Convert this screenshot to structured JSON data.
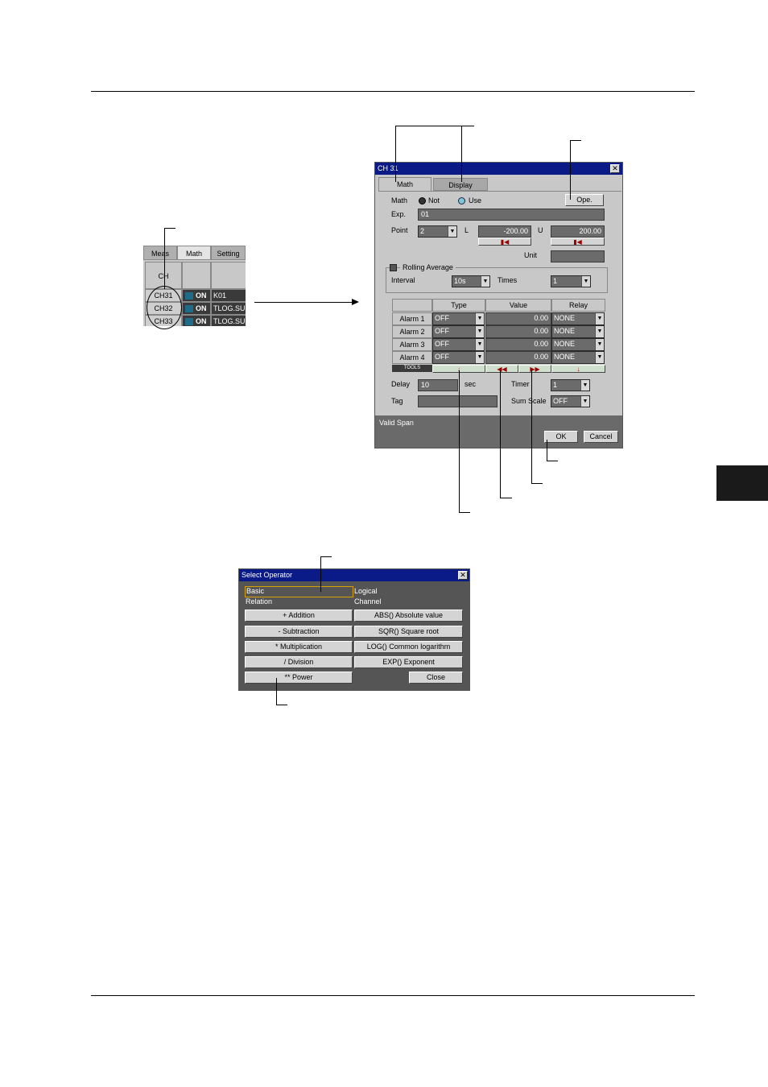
{
  "channel_list": {
    "tabs": [
      "Meas",
      "Math",
      "Setting"
    ],
    "ch_header": "CH",
    "rows": [
      {
        "ch": "CH31",
        "status": "ON",
        "expr": "K01"
      },
      {
        "ch": "CH32",
        "status": "ON",
        "expr": "TLOG.SUM"
      },
      {
        "ch": "CH33",
        "status": "ON",
        "expr": "TLOG.SUM"
      }
    ]
  },
  "dialog": {
    "title": "CH 31",
    "tabs": [
      "Math",
      "Display"
    ],
    "math_label": "Math",
    "math_not": "Not",
    "math_use": "Use",
    "ope_button": "Ope.",
    "exp_label": "Exp.",
    "exp_value": "01",
    "point_label": "Point",
    "point_value": "2",
    "l_label": "L",
    "l_value": "-200.00",
    "u_label": "U",
    "u_value": "200.00",
    "unit_label": "Unit",
    "unit_value": "",
    "rolling_label": "Rolling Average",
    "interval_label": "Interval",
    "interval_value": "10s",
    "times_label": "Times",
    "times_value": "1",
    "alarm_headers": [
      "Type",
      "Value",
      "Relay"
    ],
    "alarms": [
      {
        "name": "Alarm 1",
        "type": "OFF",
        "value": "0.00",
        "relay": "NONE"
      },
      {
        "name": "Alarm 2",
        "type": "OFF",
        "value": "0.00",
        "relay": "NONE"
      },
      {
        "name": "Alarm 3",
        "type": "OFF",
        "value": "0.00",
        "relay": "NONE"
      },
      {
        "name": "Alarm 4",
        "type": "OFF",
        "value": "0.00",
        "relay": "NONE"
      }
    ],
    "tools_label": "TOOLS",
    "delay_label": "Delay",
    "delay_value": "10",
    "sec_label": "sec",
    "timer_label": "Timer",
    "timer_value": "1",
    "tag_label": "Tag",
    "tag_value": "",
    "sum_scale_label": "Sum Scale",
    "sum_scale_value": "OFF",
    "status_text": "Valid Span",
    "ok_button": "OK",
    "cancel_button": "Cancel"
  },
  "operator": {
    "title": "Select Operator",
    "categories": [
      "Basic",
      "Logical",
      "Relation",
      "Channel"
    ],
    "buttons": [
      "+ Addition",
      "ABS() Absolute value",
      "- Subtraction",
      "SQR() Square root",
      "* Multiplication",
      "LOG() Common logarithm",
      "/ Division",
      "EXP() Exponent",
      "** Power"
    ],
    "close_button": "Close"
  },
  "colors": {
    "title_bar": "#0a1a86",
    "dialog_bg": "#c8c8c8",
    "field_bg": "#6b6b6b",
    "status_bar": "#6a6a6a",
    "operator_bg": "#555555",
    "on_indicator": "#1e6b8a"
  }
}
